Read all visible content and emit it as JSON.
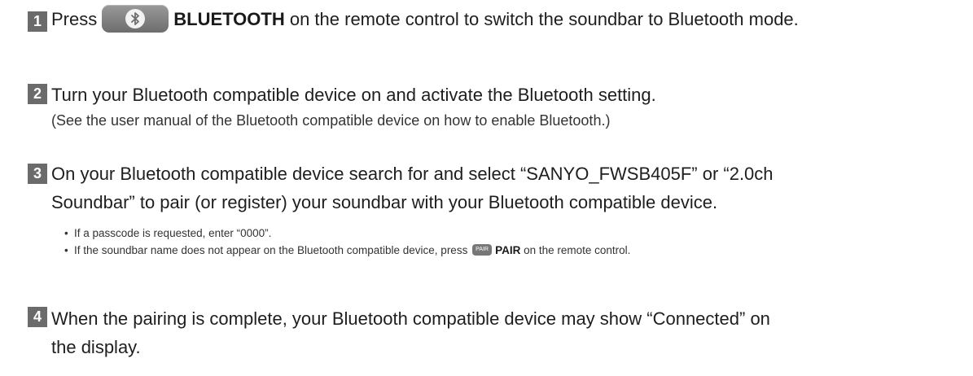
{
  "steps": [
    {
      "number": "1",
      "before": "Press",
      "button_label": "BLUETOOTH",
      "after": " on the remote control to switch the soundbar to Bluetooth mode."
    },
    {
      "number": "2",
      "text": "Turn your Bluetooth compatible device on and activate the Bluetooth setting.",
      "note": "(See the user manual of the Bluetooth compatible device on how to enable Bluetooth.)"
    },
    {
      "number": "3",
      "line1": "On your Bluetooth compatible device search for and select “SANYO_FWSB405F” or “2.0ch",
      "line2": "Soundbar” to pair (or register) your soundbar with your Bluetooth compatible device.",
      "bullets": [
        {
          "text": "If a passcode is requested, enter “0000”."
        },
        {
          "before": "If the soundbar name does not appear on the Bluetooth compatible device, press ",
          "button_icon_text": "PAIR",
          "button_label": "PAIR",
          "after": " on the remote control."
        }
      ]
    },
    {
      "number": "4",
      "line1": "When the pairing is complete, your Bluetooth compatible device may show “Connected” on",
      "line2": "the display."
    }
  ],
  "colors": {
    "step_badge": "#6b6b6b",
    "button": "#7a7a7a",
    "text": "#1e1e1e"
  },
  "icons": {
    "bluetooth": "bluetooth-icon",
    "pair": "pair-icon"
  }
}
